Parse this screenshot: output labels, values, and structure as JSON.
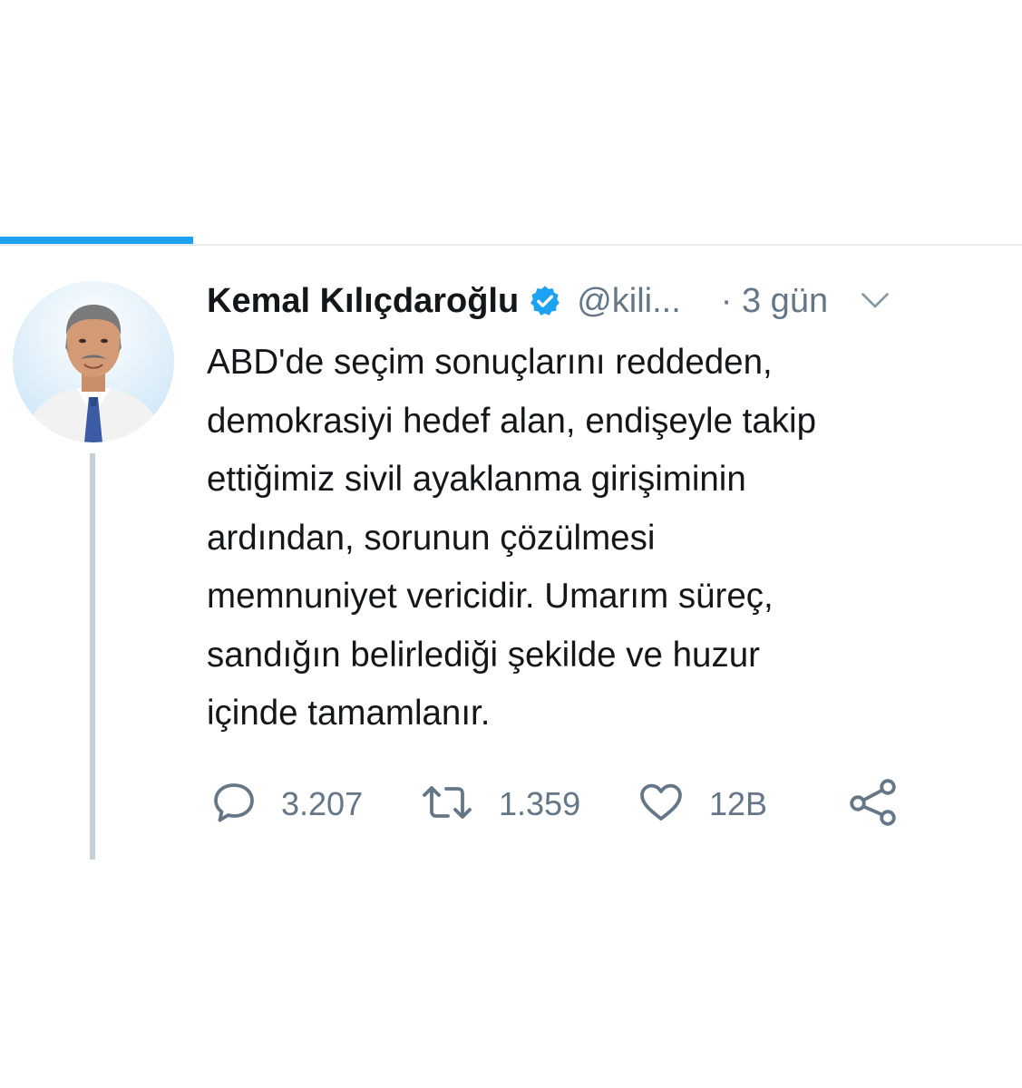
{
  "icons": {
    "verified": "verified-badge-icon",
    "chevron": "chevron-down-icon",
    "reply": "reply-bubble-icon",
    "retweet": "retweet-icon",
    "like": "heart-icon",
    "share": "share-icon"
  },
  "colors": {
    "accent": "#1da1f2",
    "secondary_text": "#657786",
    "primary_text": "#14171a",
    "thread_line": "#c4cfd6"
  },
  "tweet": {
    "author": {
      "display_name": "Kemal Kılıçdaroğlu",
      "handle": "@kili..."
    },
    "timestamp": "· 3 gün",
    "text": "ABD'de seçim sonuçlarını reddeden,\ndemokrasiyi hedef alan, endişeyle takip\nettiğimiz sivil ayaklanma girişiminin\nardından, sorunun çözülmesi\nmemnuniyet vericidir. Umarım süreç,\nsandığın belirlediği  şekilde ve huzur\niçinde tamamlanır.",
    "actions": {
      "replies": "3.207",
      "retweets": "1.359",
      "likes": "12B"
    }
  }
}
